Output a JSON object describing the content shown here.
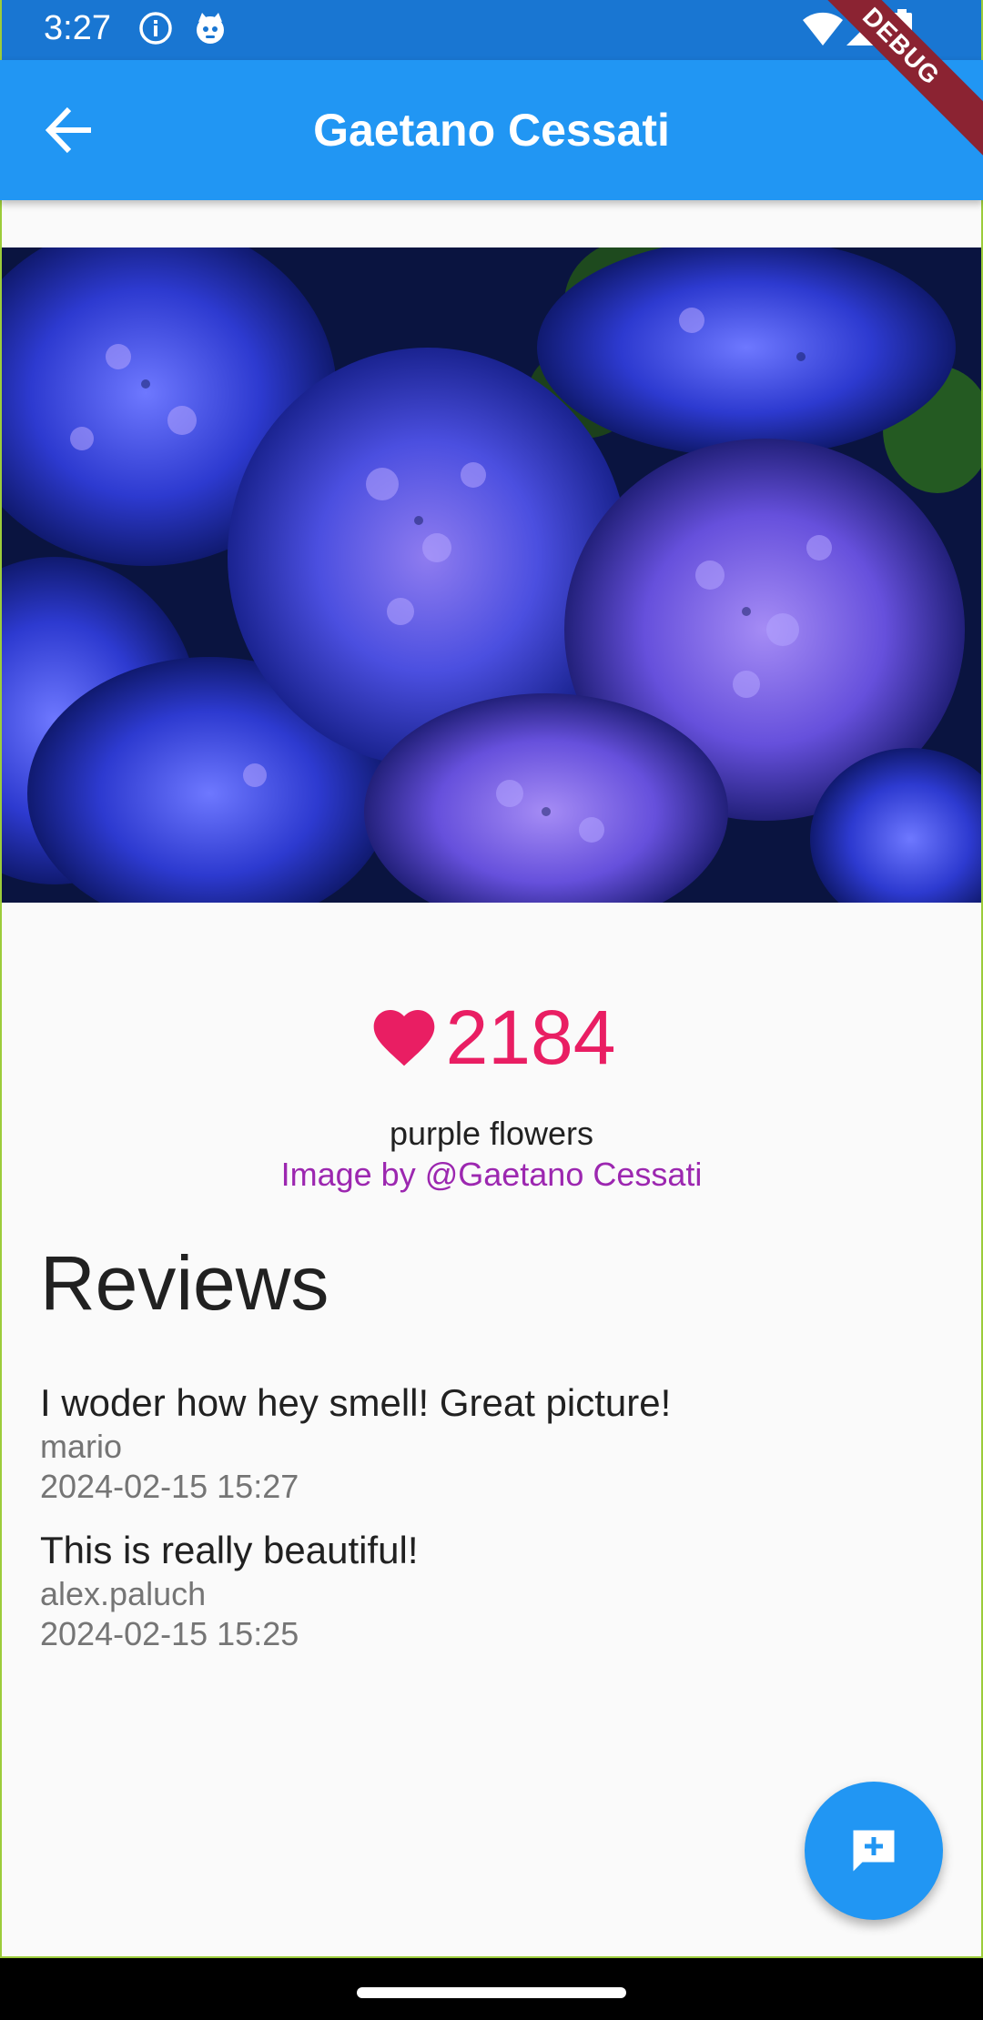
{
  "status_bar": {
    "time": "3:27",
    "icons_left": [
      "info-icon",
      "cat-face-icon"
    ],
    "icons_right": [
      "wifi-icon",
      "signal-icon",
      "battery-icon"
    ]
  },
  "app_bar": {
    "title": "Gaetano Cessati",
    "back_icon": "arrow-back-icon",
    "debug_banner": "DEBUG"
  },
  "photo": {
    "alt": "purple flowers"
  },
  "likes": {
    "icon": "heart-icon",
    "count": "2184",
    "color": "#e91e63"
  },
  "image_info": {
    "title": "purple flowers",
    "credit": "Image by @Gaetano Cessati",
    "credit_color": "#9c27b0"
  },
  "reviews": {
    "heading": "Reviews",
    "items": [
      {
        "text": "I woder how hey smell! Great picture!",
        "author": "mario",
        "timestamp": "2024-02-15 15:27"
      },
      {
        "text": "This is really beautiful!",
        "author": "alex.paluch",
        "timestamp": "2024-02-15 15:25"
      }
    ]
  },
  "fab": {
    "icon": "add-comment-icon",
    "color": "#2196f3"
  },
  "colors": {
    "status_bar": "#1976d2",
    "app_bar": "#2196f3",
    "background": "#fafafa"
  }
}
